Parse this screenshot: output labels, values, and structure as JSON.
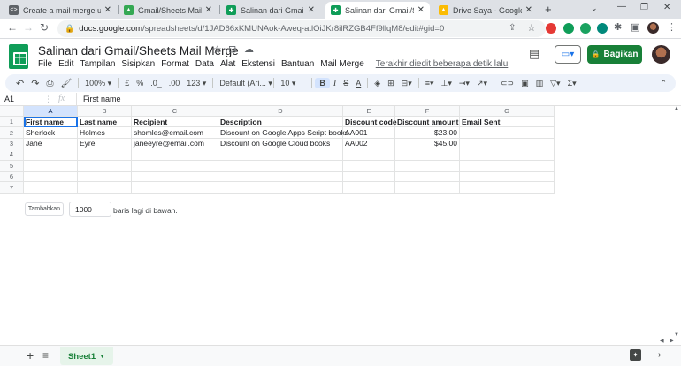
{
  "browser": {
    "tabs": [
      {
        "title": "Create a mail merge usin",
        "favicon_color": "#5f6368",
        "favicon_glyph": "<>"
      },
      {
        "title": "Gmail/Sheets Mail Merge",
        "favicon_color": "#34a853",
        "favicon_glyph": "▲"
      },
      {
        "title": "Salinan dari Gmail/Sheets",
        "favicon_color": "#0f9d58",
        "favicon_glyph": "✚"
      },
      {
        "title": "Salinan dari Gmail/Sheets",
        "favicon_color": "#0f9d58",
        "favicon_glyph": "✚"
      },
      {
        "title": "Drive Saya - Google Drive",
        "favicon_color": "#fbbc04",
        "favicon_glyph": "▲"
      }
    ],
    "new_tab_glyph": "+",
    "url_domain": "docs.google.com",
    "url_path": "/spreadsheets/d/1JAD66xKMUNAok-Aweq-atlOiJKr8ilRZGB4Ff9llqM8/edit#gid=0"
  },
  "doc": {
    "title": "Salinan dari Gmail/Sheets Mail Merge",
    "menu": [
      "File",
      "Edit",
      "Tampilan",
      "Sisipkan",
      "Format",
      "Data",
      "Alat",
      "Ekstensi",
      "Bantuan",
      "Mail Merge"
    ],
    "last_edit": "Terakhir diedit beberapa detik lalu",
    "share_label": "Bagikan"
  },
  "toolbar": {
    "zoom": "100%",
    "currency": "£",
    "percent": "%",
    "dec_less": ".0_",
    "dec_more": ".00",
    "format_more": "123",
    "font": "Default (Ari...",
    "font_size": "10",
    "bold": "B",
    "italic": "I",
    "strike": "S",
    "text_color": "A"
  },
  "formula_bar": {
    "cell_ref": "A1",
    "fx": "fx",
    "content": "First name"
  },
  "grid": {
    "columns": [
      "A",
      "B",
      "C",
      "D",
      "E",
      "F",
      "G"
    ],
    "rows": [
      "1",
      "2",
      "3",
      "4",
      "5",
      "6",
      "7"
    ],
    "data": [
      [
        "First name",
        "Last name",
        "Recipient",
        "Description",
        "Discount code",
        "Discount amount",
        "Email Sent"
      ],
      [
        "Sherlock",
        "Holmes",
        "shomles@email.com",
        "Discount on Google Apps Script books",
        "AA001",
        "$23.00",
        ""
      ],
      [
        "Jane",
        "Eyre",
        "janeeyre@email.com",
        "Discount on Google Cloud books",
        "AA002",
        "$45.00",
        ""
      ]
    ]
  },
  "add_rows": {
    "button_label": "Tambahkan",
    "count": "1000",
    "suffix": "baris lagi di bawah."
  },
  "bottom": {
    "sheet_name": "Sheet1"
  }
}
